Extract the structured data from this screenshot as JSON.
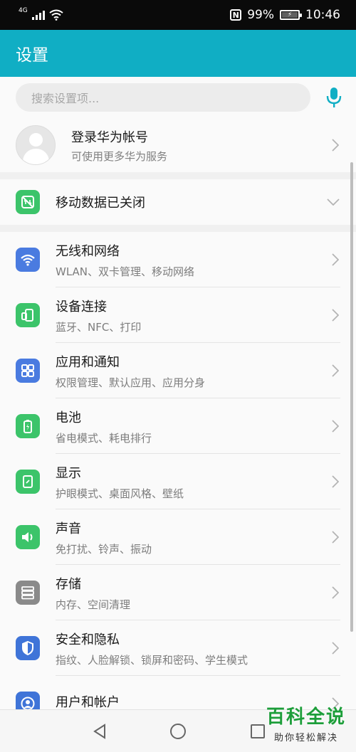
{
  "status_bar": {
    "network_type": "4G",
    "nfc_label": "N",
    "battery_percent": "99%",
    "time": "10:46"
  },
  "app_bar": {
    "title": "设置"
  },
  "search": {
    "placeholder": "搜索设置项..."
  },
  "account": {
    "title": "登录华为帐号",
    "subtitle": "可使用更多华为服务"
  },
  "mobile_data": {
    "title": "移动数据已关闭"
  },
  "settings": [
    {
      "title": "无线和网络",
      "subtitle": "WLAN、双卡管理、移动网络",
      "icon": "wifi-icon",
      "color": "#4a7be0"
    },
    {
      "title": "设备连接",
      "subtitle": "蓝牙、NFC、打印",
      "icon": "device-connection-icon",
      "color": "#3cc46a"
    },
    {
      "title": "应用和通知",
      "subtitle": "权限管理、默认应用、应用分身",
      "icon": "apps-grid-icon",
      "color": "#4a7be0"
    },
    {
      "title": "电池",
      "subtitle": "省电模式、耗电排行",
      "icon": "battery-icon",
      "color": "#3cc46a"
    },
    {
      "title": "显示",
      "subtitle": "护眼模式、桌面风格、壁纸",
      "icon": "display-icon",
      "color": "#3cc46a"
    },
    {
      "title": "声音",
      "subtitle": "免打扰、铃声、振动",
      "icon": "speaker-icon",
      "color": "#3cc46a"
    },
    {
      "title": "存储",
      "subtitle": "内存、空间清理",
      "icon": "storage-icon",
      "color": "#8a8a8a"
    },
    {
      "title": "安全和隐私",
      "subtitle": "指纹、人脸解锁、锁屏和密码、学生模式",
      "icon": "shield-icon",
      "color": "#3f74d8"
    },
    {
      "title": "用户和帐户",
      "subtitle": "",
      "icon": "user-icon",
      "color": "#3f74d8"
    }
  ],
  "colors": {
    "accent": "#10aec4",
    "green": "#3cc46a",
    "blue": "#4a7be0"
  },
  "watermark": {
    "title": "百科全说",
    "subtitle": "助你轻松解决"
  }
}
